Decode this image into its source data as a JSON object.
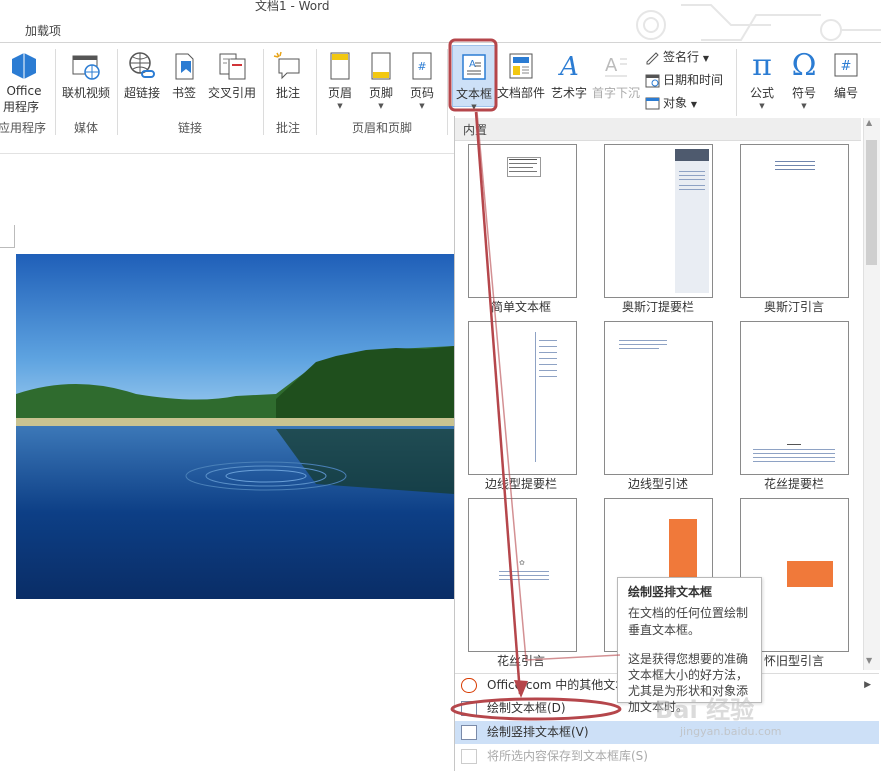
{
  "window": {
    "title": "文档1 - Word"
  },
  "tabs": {
    "addins": "加载项"
  },
  "ribbon": {
    "office_apps": "Office\n应用程序",
    "office_apps_l1": "Office",
    "office_apps_l2": "用程序",
    "online_video": "联机视频",
    "hyperlink": "超链接",
    "bookmark": "书签",
    "crossref": "交叉引用",
    "comment": "批注",
    "header": "页眉",
    "footer": "页脚",
    "pagenum": "页码",
    "textbox": "文本框",
    "quickparts": "文档部件",
    "wordart": "艺术字",
    "dropcap": "首字下沉",
    "signature": "签名行",
    "datetime": "日期和时间",
    "object": "对象",
    "equation": "公式",
    "symbol": "符号",
    "number": "编号",
    "groups": {
      "apps": "应用程序",
      "media": "媒体",
      "links": "链接",
      "comments": "批注",
      "headerfooter": "页眉和页脚"
    }
  },
  "gallery": {
    "section": "内置",
    "items": [
      "简单文本框",
      "奥斯汀提要栏",
      "奥斯汀引言",
      "边线型提要栏",
      "边线型引述",
      "花丝提要栏",
      "花丝引言",
      "",
      "怀旧型引言"
    ]
  },
  "menu": {
    "more": "Office.com 中的其他文本",
    "draw": "绘制文本框(D)",
    "draw_vertical": "绘制竖排文本框(V)",
    "save": "将所选内容保存到文本框库(S)"
  },
  "tooltip": {
    "title": "绘制竖排文本框",
    "line1": "在文档的任何位置绘制",
    "line2": "垂直文本框。",
    "line3": "这是获得您想要的准确",
    "line4": "文本框大小的好方法，",
    "line5": "尤其是为形状和对象添",
    "line6": "加文本时。"
  },
  "watermark": {
    "text": "Bai 经验",
    "url": "jingyan.baidu.com"
  },
  "colors": {
    "accent": "#2b579a",
    "annotation": "#b5464b",
    "highlight": "#cde0f7",
    "orange": "#f0793a"
  }
}
